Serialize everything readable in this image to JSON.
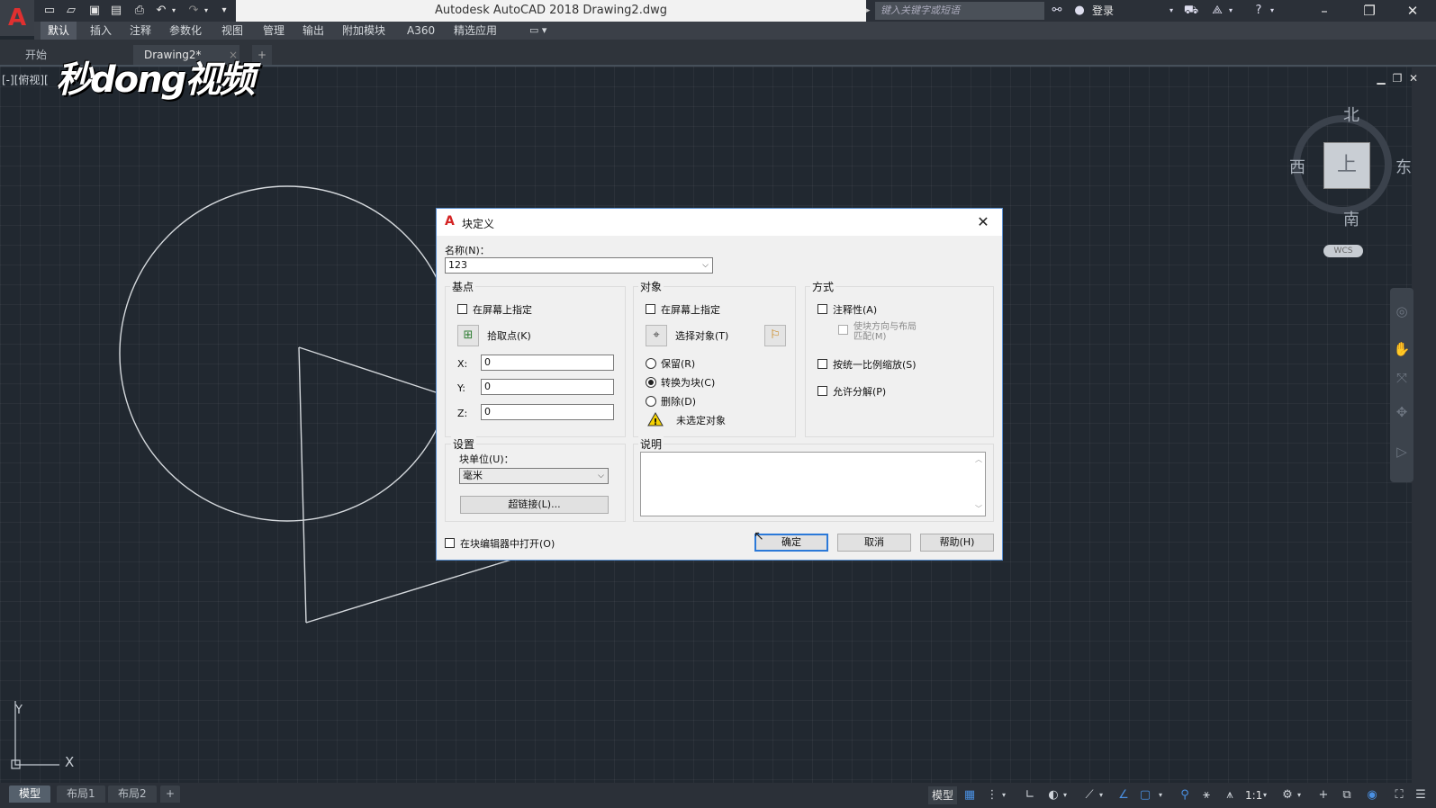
{
  "window": {
    "title": "Autodesk AutoCAD 2018    Drawing2.dwg",
    "search_placeholder": "键入关键字或短语",
    "login": "登录",
    "logo": "A"
  },
  "ribbon_tabs": [
    "默认",
    "插入",
    "注释",
    "参数化",
    "视图",
    "管理",
    "输出",
    "附加模块",
    "A360",
    "精选应用"
  ],
  "doc_tabs": {
    "start": "开始",
    "drawing": "Drawing2*"
  },
  "viewport": {
    "label": "[-][俯视][",
    "watermark": "秒dong视频",
    "compass": {
      "north": "北",
      "south": "南",
      "east": "东",
      "west": "西",
      "face": "上"
    },
    "wcs": "WCS",
    "ucs": {
      "x": "X",
      "y": "Y"
    }
  },
  "layout_tabs": [
    "模型",
    "布局1",
    "布局2"
  ],
  "status": {
    "model": "模型",
    "scale": "1:1"
  },
  "dialog": {
    "title": "块定义",
    "name_label": "名称(N)：",
    "name_value": "123",
    "base": {
      "title": "基点",
      "on_screen": "在屏幕上指定",
      "pick_point": "拾取点(K)",
      "x_label": "X:",
      "x_value": "0",
      "y_label": "Y:",
      "y_value": "0",
      "z_label": "Z:",
      "z_value": "0"
    },
    "objects": {
      "title": "对象",
      "on_screen": "在屏幕上指定",
      "select_objects": "选择对象(T)",
      "retain": "保留(R)",
      "convert": "转换为块(C)",
      "delete": "删除(D)",
      "warning": "未选定对象"
    },
    "behavior": {
      "title": "方式",
      "annotative": "注释性(A)",
      "match_line1": "使块方向与布局",
      "match_line2": "匹配(M)",
      "uniform_scale": "按统一比例缩放(S)",
      "allow_explode": "允许分解(P)"
    },
    "settings": {
      "title": "设置",
      "unit_label": "块单位(U)：",
      "unit_value": "毫米",
      "hyperlink": "超链接(L)..."
    },
    "description": {
      "title": "说明"
    },
    "open_in_editor": "在块编辑器中打开(O)",
    "ok": "确定",
    "cancel": "取消",
    "help": "帮助(H)"
  }
}
